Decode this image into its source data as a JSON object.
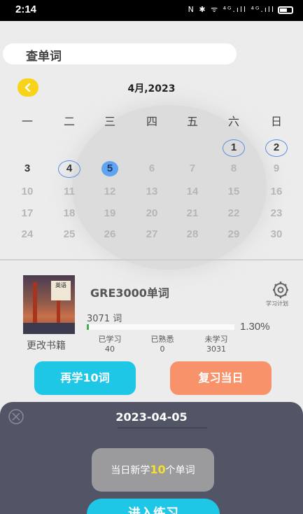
{
  "status_bar": {
    "time": "2:14",
    "indicators": "N ✱ ᯤ ⁴ᴳ.ıll ⁴ᴳ.ıll"
  },
  "search": {
    "label": "查单词"
  },
  "calendar": {
    "title": "4月,2023",
    "weekdays": [
      "一",
      "二",
      "三",
      "四",
      "五",
      "六",
      "日"
    ],
    "rows": [
      [
        "",
        "",
        "",
        "",
        "",
        "1",
        "2"
      ],
      [
        "3",
        "4",
        "5",
        "6",
        "7",
        "8",
        "9"
      ],
      [
        "10",
        "11",
        "12",
        "13",
        "14",
        "15",
        "16"
      ],
      [
        "17",
        "18",
        "19",
        "20",
        "21",
        "22",
        "23"
      ],
      [
        "24",
        "25",
        "26",
        "27",
        "28",
        "29",
        "30"
      ]
    ],
    "selected_day": "5",
    "marked_days": [
      "1",
      "2",
      "4"
    ],
    "dark_days": [
      "3"
    ]
  },
  "book": {
    "cover_text": "英语",
    "name": "GRE3000单词",
    "word_count": "3071 词",
    "progress_percent": 1.3,
    "progress_label": "1.30%",
    "change_label": "更改书籍",
    "plan_label": "学习计划",
    "stats": [
      {
        "label": "已学习",
        "value": "40"
      },
      {
        "label": "已熟悉",
        "value": "0"
      },
      {
        "label": "未学习",
        "value": "3031"
      }
    ]
  },
  "actions": {
    "learn_more": "再学10词",
    "review_today": "复习当日"
  },
  "sheet": {
    "date": "2023-04-05",
    "summary_prefix": "当日新学",
    "summary_count": "10",
    "summary_suffix": "个单词",
    "enter_label": "进入练习"
  },
  "colors": {
    "accent_blue": "#1fc7e6",
    "accent_orange": "#f7926b",
    "accent_yellow": "#f7d31a",
    "sheet_bg": "#525566"
  }
}
